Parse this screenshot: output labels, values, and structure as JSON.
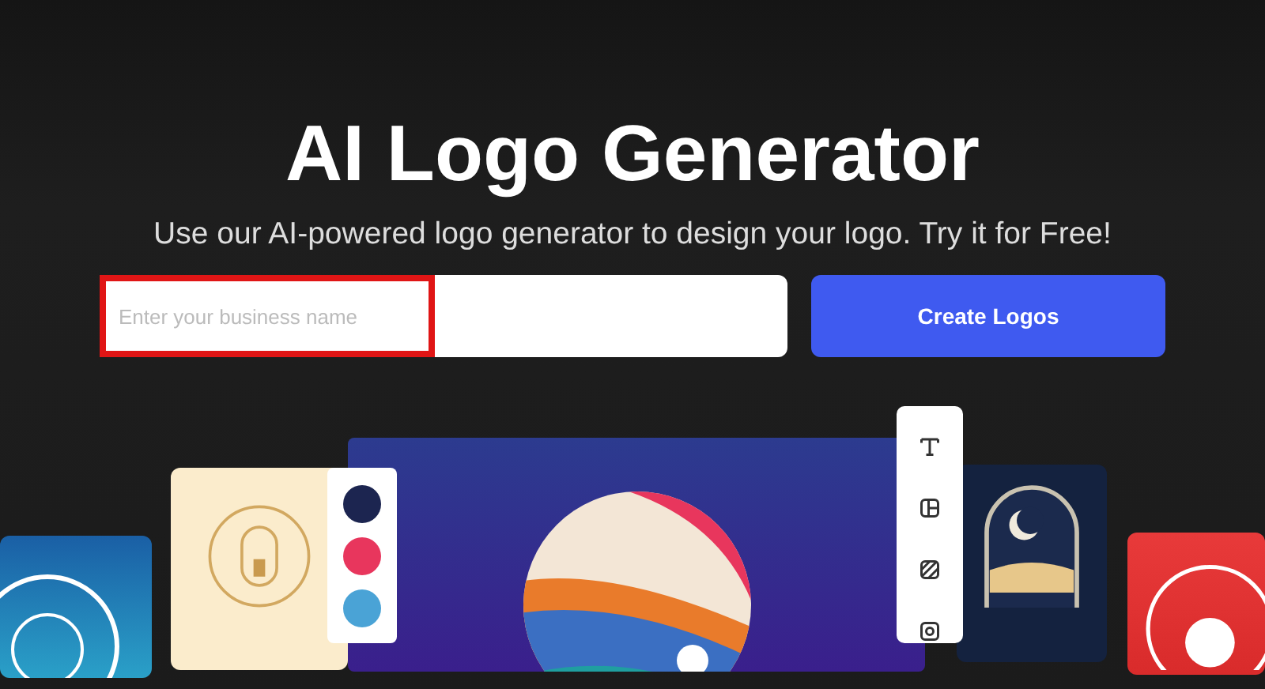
{
  "hero": {
    "title": "AI Logo Generator",
    "subtitle": "Use our AI-powered logo generator to design your logo. Try it for Free!"
  },
  "search": {
    "placeholder": "Enter your business name",
    "highlighted": true
  },
  "button": {
    "label": "Create Logos"
  },
  "palette": [
    {
      "color": "#1c2550"
    },
    {
      "color": "#e8365d"
    },
    {
      "color": "#4aa3d6"
    }
  ]
}
